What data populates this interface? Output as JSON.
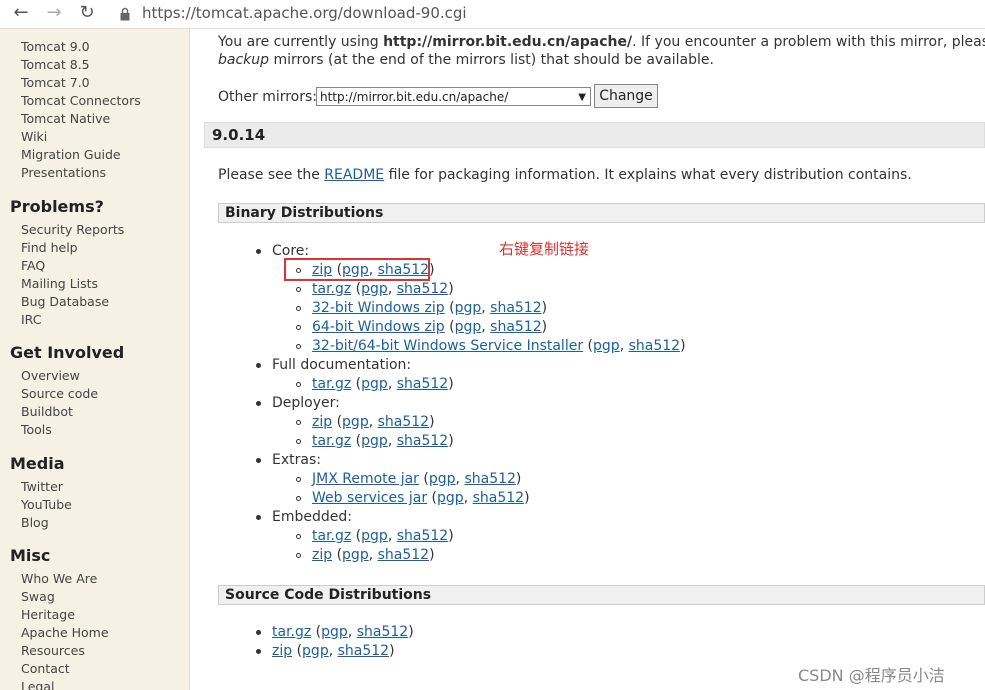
{
  "browser": {
    "url": "https://tomcat.apache.org/download-90.cgi"
  },
  "sidebar": {
    "top_links": [
      "Tomcat 9.0",
      "Tomcat 8.5",
      "Tomcat 7.0",
      "Tomcat Connectors",
      "Tomcat Native",
      "Wiki",
      "Migration Guide",
      "Presentations"
    ],
    "problems": {
      "title": "Problems?",
      "links": [
        "Security Reports",
        "Find help",
        "FAQ",
        "Mailing Lists",
        "Bug Database",
        "IRC"
      ]
    },
    "get_involved": {
      "title": "Get Involved",
      "links": [
        "Overview",
        "Source code",
        "Buildbot",
        "Tools"
      ]
    },
    "media": {
      "title": "Media",
      "links": [
        "Twitter",
        "YouTube",
        "Blog"
      ]
    },
    "misc": {
      "title": "Misc",
      "links": [
        "Who We Are",
        "Swag",
        "Heritage",
        "Apache Home",
        "Resources",
        "Contact",
        "Legal"
      ]
    }
  },
  "main": {
    "mirror_line1_pre": "You are currently using ",
    "mirror_url": "http://mirror.bit.edu.cn/apache/",
    "mirror_line1_post": ". If you encounter a problem with this mirror, please select",
    "mirror_line2_em": "backup",
    "mirror_line2_post": " mirrors (at the end of the mirrors list) that should be available.",
    "other_mirrors_label": "Other mirrors:",
    "select_value": "http://mirror.bit.edu.cn/apache/",
    "change_button": "Change",
    "version": "9.0.14",
    "readme_pre": "Please see the ",
    "readme_link": "README",
    "readme_post": " file for packaging information. It explains what every distribution contains.",
    "binary_title": "Binary Distributions",
    "source_title": "Source Code Distributions",
    "annotation": "右键复制链接",
    "watermark": "CSDN @程序员小洁",
    "groups": {
      "core": "Core:",
      "full_doc": "Full documentation:",
      "deployer": "Deployer:",
      "extras": "Extras:",
      "embedded": "Embedded:"
    },
    "links": {
      "zip": "zip",
      "targz": "tar.gz",
      "pgp": "pgp",
      "sha512": "sha512",
      "win32": "32-bit Windows zip",
      "win64": "64-bit Windows zip",
      "installer": "32-bit/64-bit Windows Service Installer",
      "jmx": "JMX Remote jar",
      "ws": "Web services jar"
    }
  }
}
